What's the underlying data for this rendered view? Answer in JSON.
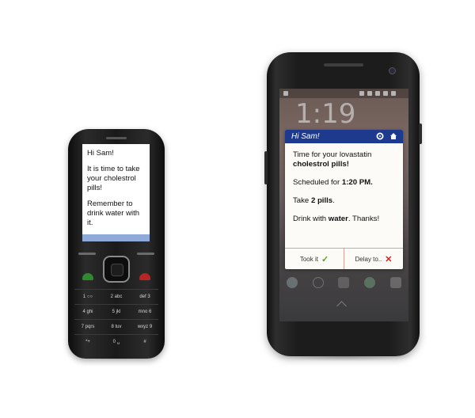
{
  "feature_phone": {
    "sms_greeting": "Hi Sam!",
    "sms_line1": "It is time to take your cholestrol pills!",
    "sms_line2": "Remember to drink water with it.",
    "keypad": [
      [
        "1 ○○",
        "2 abc",
        "def 3"
      ],
      [
        "4 ghi",
        "5 jkl",
        "mno 6"
      ],
      [
        "7 pqrs",
        "8 tuv",
        "wxyz 9"
      ],
      [
        "*+",
        "0 ␣",
        "#"
      ]
    ]
  },
  "smartphone": {
    "lock_clock": "1:19",
    "notification": {
      "header_title": "Hi Sam!",
      "line1_text": "Time for your lovastatin",
      "line1_bold": "cholestrol pills!",
      "line2_text": "Scheduled for ",
      "line2_bold": "1:20 PM.",
      "line3_text": "Take ",
      "line3_bold": "2 pills",
      "line3_end": ".",
      "line4_text": "Drink with ",
      "line4_bold": "water",
      "line4_end": ". Thanks!",
      "took_it_label": "Took it",
      "took_it_icon": "✓",
      "delay_label": "Delay to..",
      "delay_icon": "✕"
    }
  },
  "colors": {
    "header_blue": "#1d3a8f",
    "check_green": "#5aa02c",
    "cross_red": "#d42020",
    "sms_bar": "#8fa9d8"
  }
}
